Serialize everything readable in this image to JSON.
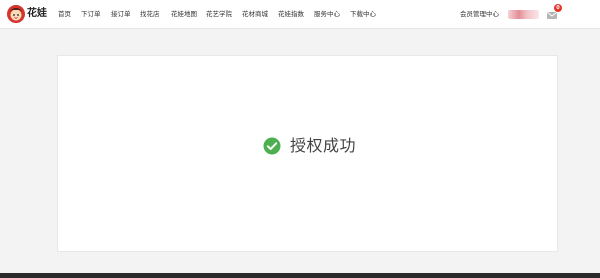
{
  "header": {
    "brand": "花娃",
    "nav": [
      {
        "label": "首页"
      },
      {
        "label": "下订单"
      },
      {
        "label": "接订单"
      },
      {
        "label": "找花店"
      },
      {
        "label": "花娃地图"
      },
      {
        "label": "花艺学院"
      },
      {
        "label": "花材商城"
      },
      {
        "label": "花娃指数"
      },
      {
        "label": "服务中心"
      },
      {
        "label": "下载中心"
      }
    ],
    "member_center": "会员管理中心",
    "mail_badge": "0",
    "icons": {
      "logo": "huawa-logo",
      "mail": "mail-icon"
    }
  },
  "main": {
    "status_text": "授权成功",
    "status_icon": "check-circle-icon",
    "status_color": "#4caf50"
  }
}
